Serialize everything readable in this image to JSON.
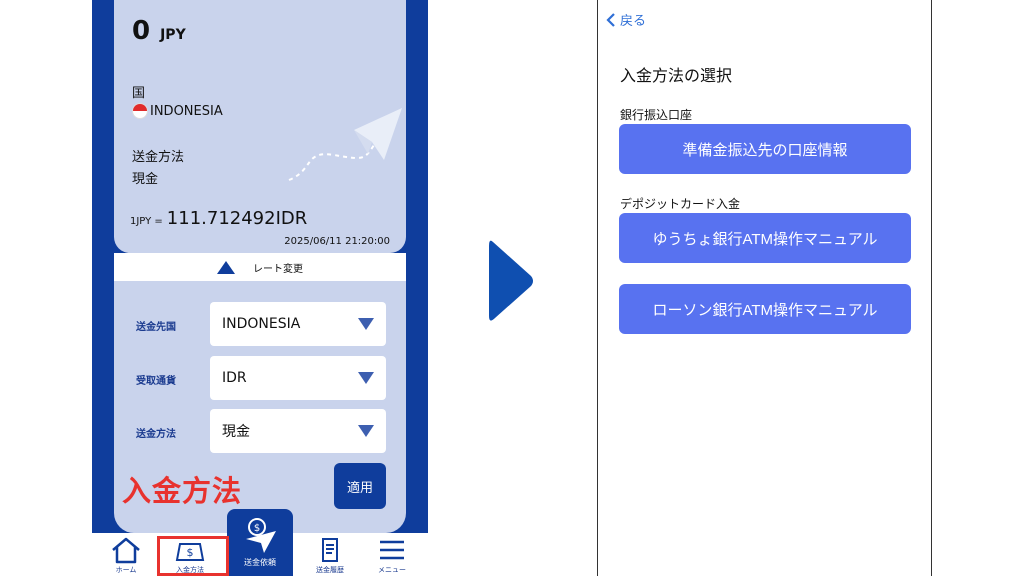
{
  "left_screen": {
    "balance": {
      "amount": "0",
      "currency": "JPY"
    },
    "country_label": "国",
    "country_value": "INDONESIA",
    "method_label": "送金方法",
    "method_value": "現金",
    "rate": {
      "prefix": "1JPY =",
      "value": "111.712492IDR",
      "timestamp": "2025/06/11 21:20:00"
    },
    "rate_change_label": "レート変更",
    "form": {
      "rows": [
        {
          "label": "送金先国",
          "value": "INDONESIA"
        },
        {
          "label": "受取通貨",
          "value": "IDR"
        },
        {
          "label": "送金方法",
          "value": "現金"
        }
      ],
      "apply_label": "適用"
    },
    "overlay_label": "入金方法",
    "tabs": {
      "home": "ホーム",
      "deposit": "入金方法",
      "send": "送金依頼",
      "history": "送金履歴",
      "menu": "メニュー"
    },
    "colors": {
      "primary": "#0f3d9c",
      "card": "#c9d3ec",
      "highlight": "#e8322e"
    }
  },
  "right_screen": {
    "back_label": "戻る",
    "title": "入金方法の選択",
    "section_bank": "銀行振込口座",
    "btn_account_info": "準備金振込先の口座情報",
    "section_deposit_card": "デポジットカード入金",
    "btn_yucho": "ゆうちょ銀行ATM操作マニュアル",
    "btn_lawson": "ローソン銀行ATM操作マニュアル",
    "colors": {
      "button": "#5872f0",
      "link": "#2f6fd6"
    }
  },
  "arrow_color": "#0f4fb0"
}
